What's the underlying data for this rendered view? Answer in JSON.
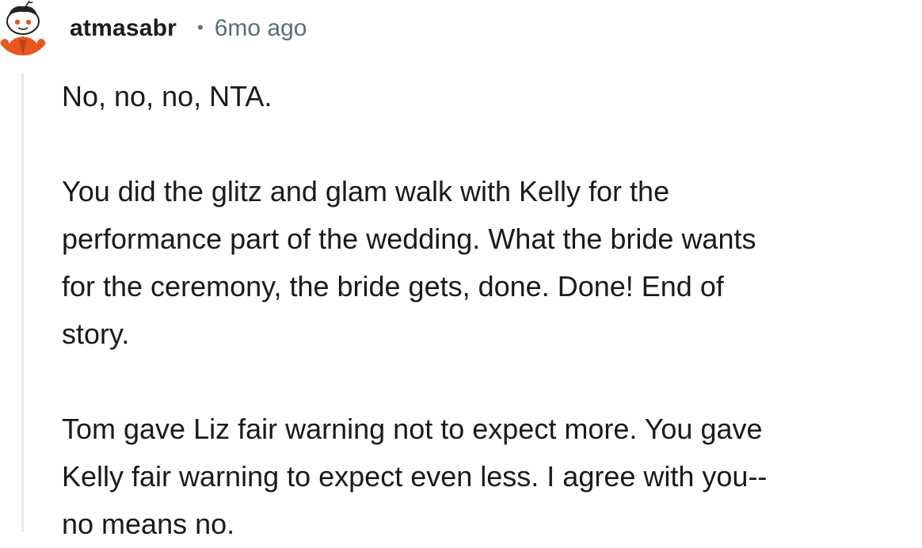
{
  "comment": {
    "author": "atmasabr",
    "separator": "•",
    "timestamp": "6mo ago",
    "avatar_icon": "snoo-avatar-icon",
    "paragraphs": [
      "No, no, no, NTA.",
      "You did the glitz and glam walk with Kelly for the\nperformance part of the wedding. What the bride wants\nfor the ceremony, the bride gets, done. Done! End of\nstory.",
      "Tom gave Liz fair warning not to expect more. You gave\nKelly fair warning to expect even less. I agree with you--\nno means no."
    ],
    "colors": {
      "username": "#1c1c1c",
      "meta": "#576f76",
      "thread_line": "#e5ebee",
      "avatar_accent": "#e8571f"
    }
  }
}
